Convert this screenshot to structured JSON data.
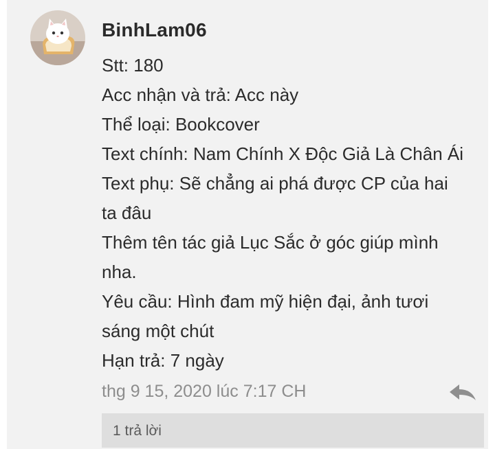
{
  "comment": {
    "username": "BinhLam06",
    "lines": [
      "Stt: 180",
      "Acc nhận và trả: Acc này",
      "Thể loại: Bookcover",
      "Text chính: Nam Chính X Độc Giả Là Chân Ái",
      "Text phụ: Sẽ chẳng ai phá được CP của hai",
      "ta đâu",
      "Thêm tên tác giả Lục Sắc ở góc giúp mình",
      "nha.",
      "Yêu cầu: Hình đam mỹ hiện đại, ảnh tươi",
      "sáng một chút",
      "Hạn trả: 7 ngày"
    ],
    "timestamp": "thg 9 15, 2020 lúc 7:17 CH",
    "reply_icon": "reply-arrow-icon",
    "replies_label": "1 trả lời"
  },
  "colors": {
    "card_bg": "#f2f2f2",
    "text": "#2b2b2b",
    "muted": "#8d8d8d",
    "replies_bg": "#dedede"
  }
}
